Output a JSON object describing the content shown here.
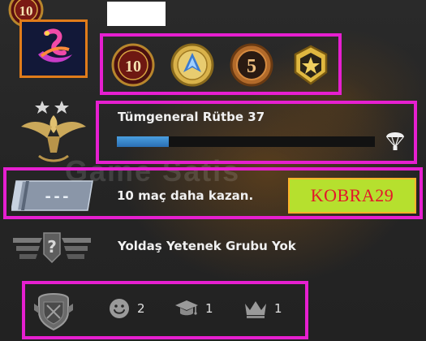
{
  "service_medal": {
    "number": "10"
  },
  "profile": {
    "name_box": ""
  },
  "coins": [
    {
      "label": "10",
      "icon": "service-medal-10-icon"
    },
    {
      "label": "",
      "icon": "operation-coin-icon"
    },
    {
      "label": "5",
      "icon": "service-medal-5-icon"
    },
    {
      "label": "",
      "icon": "operation-star-coin-icon"
    }
  ],
  "rank": {
    "title": "Tümgeneral Rütbe 37",
    "progress": 0.2,
    "icon": "parachute-icon"
  },
  "watermark": "Game Satis",
  "wins": {
    "badge_text": "---",
    "text": "10 maç daha kazan.",
    "code": "KOBRA29"
  },
  "skill_group": {
    "badge_text": "?",
    "text": "Yoldaş Yetenek Grubu Yok"
  },
  "commendations": {
    "friendly": {
      "icon": "smiley-icon",
      "count": "2"
    },
    "teacher": {
      "icon": "graduation-cap-icon",
      "count": "1"
    },
    "leader": {
      "icon": "crown-icon",
      "count": "1"
    }
  },
  "colors": {
    "highlight": "#e61fd0",
    "avatar_border": "#e07b1a",
    "xp_bar": "#3a8ad0",
    "code_bg": "#b6e02e",
    "code_text": "#e3162a"
  }
}
